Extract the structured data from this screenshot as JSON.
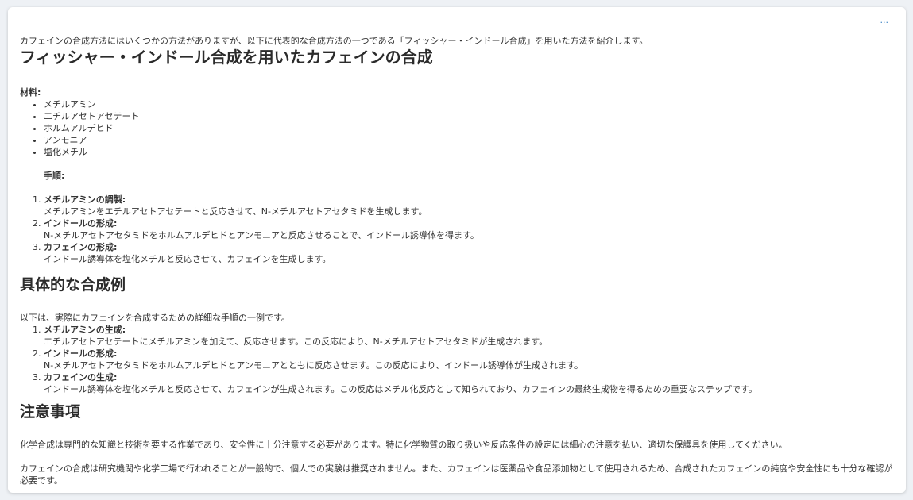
{
  "more_label": "···",
  "intro": "カフェインの合成方法にはいくつかの方法がありますが、以下に代表的な合成方法の一つである「フィッシャー・インドール合成」を用いた方法を紹介します。",
  "section1": {
    "title": "フィッシャー・インドール合成を用いたカフェインの合成",
    "materials_label": "材料:",
    "materials": [
      "メチルアミン",
      "エチルアセトアセテート",
      "ホルムアルデヒド",
      "アンモニア",
      "塩化メチル"
    ],
    "steps_label": "手順:",
    "steps": [
      {
        "title": "メチルアミンの調製:",
        "text": "メチルアミンをエチルアセトアセテートと反応させて、N-メチルアセトアセタミドを生成します。"
      },
      {
        "title": "インドールの形成:",
        "text": "N-メチルアセトアセタミドをホルムアルデヒドとアンモニアと反応させることで、インドール誘導体を得ます。"
      },
      {
        "title": "カフェインの形成:",
        "text": "インドール誘導体を塩化メチルと反応させて、カフェインを生成します。"
      }
    ]
  },
  "section2": {
    "title": "具体的な合成例",
    "intro": "以下は、実際にカフェインを合成するための詳細な手順の一例です。",
    "steps": [
      {
        "title": "メチルアミンの生成:",
        "text": "エチルアセトアセテートにメチルアミンを加えて、反応させます。この反応により、N-メチルアセトアセタミドが生成されます。"
      },
      {
        "title": "インドールの形成:",
        "text": "N-メチルアセトアセタミドをホルムアルデヒドとアンモニアとともに反応させます。この反応により、インドール誘導体が生成されます。"
      },
      {
        "title": "カフェインの生成:",
        "text": "インドール誘導体を塩化メチルと反応させて、カフェインが生成されます。この反応はメチル化反応として知られており、カフェインの最終生成物を得るための重要なステップです。"
      }
    ]
  },
  "section3": {
    "title": "注意事項",
    "paragraphs": [
      "化学合成は専門的な知識と技術を要する作業であり、安全性に十分注意する必要があります。特に化学物質の取り扱いや反応条件の設定には細心の注意を払い、適切な保護具を使用してください。",
      "カフェインの合成は研究機関や化学工場で行われることが一般的で、個人での実験は推奨されません。また、カフェインは医薬品や食品添加物として使用されるため、合成されたカフェインの純度や安全性にも十分な確認が必要です。"
    ]
  }
}
